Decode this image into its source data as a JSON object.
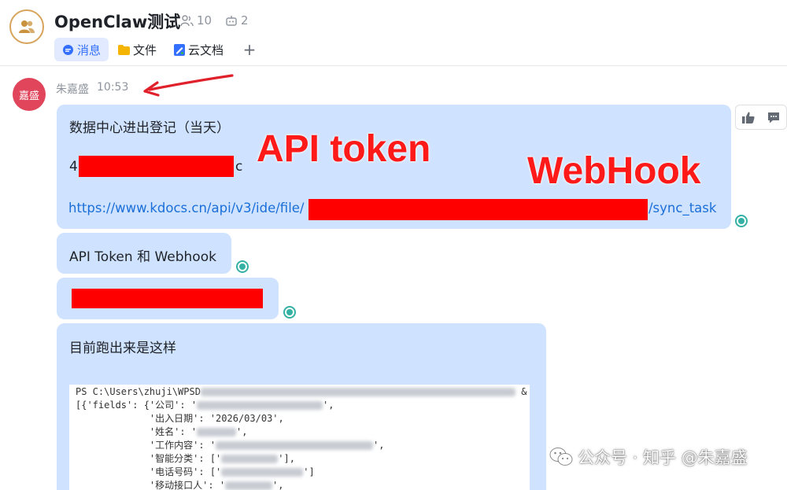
{
  "header": {
    "title": "OpenClaw测试",
    "member_count": "10",
    "bot_count": "2",
    "tabs": [
      {
        "label": "消息",
        "active": true
      },
      {
        "label": "文件",
        "active": false
      },
      {
        "label": "云文档",
        "active": false
      }
    ],
    "add_tab": "+"
  },
  "message": {
    "avatar_text": "嘉盛",
    "sender": "朱嘉盛",
    "time": "10:53",
    "bubble1": {
      "line1": "数据中心进出登记（当天）",
      "token_prefix": "4",
      "token_suffix": "c",
      "link_prefix": "https://www.kdocs.cn/api/v3/ide/file/",
      "link_suffix": "/sync_task"
    },
    "bubble2": "API Token 和 Webhook",
    "bubble4": {
      "line1": "目前跑出来是这样",
      "terminal": [
        "PS C:\\Users\\zhuji\\WPSD",
        "[{'fields': {'公司': '",
        "             '出入日期': '2026/03/03',",
        "             '姓名': '",
        "             '工作内容': '",
        "             '智能分类': ['",
        "             '电话号码': ['",
        "             '移动接口人': '"
      ],
      "terminal_tail": {
        "line1": "&",
        "line2": "',",
        "line4": "',",
        "line5": "',",
        "line6": "'],",
        "line7": "']",
        "line8": "',"
      }
    }
  },
  "annotations": {
    "api_token": "API token",
    "webhook": "WebHook"
  },
  "watermark": {
    "text": "公众号 · 知乎 @朱嘉盛"
  },
  "colors": {
    "accent": "#3370ff",
    "bubble": "#cfe2ff",
    "redaction": "#ff0000",
    "read_mark": "#34b1a4"
  }
}
